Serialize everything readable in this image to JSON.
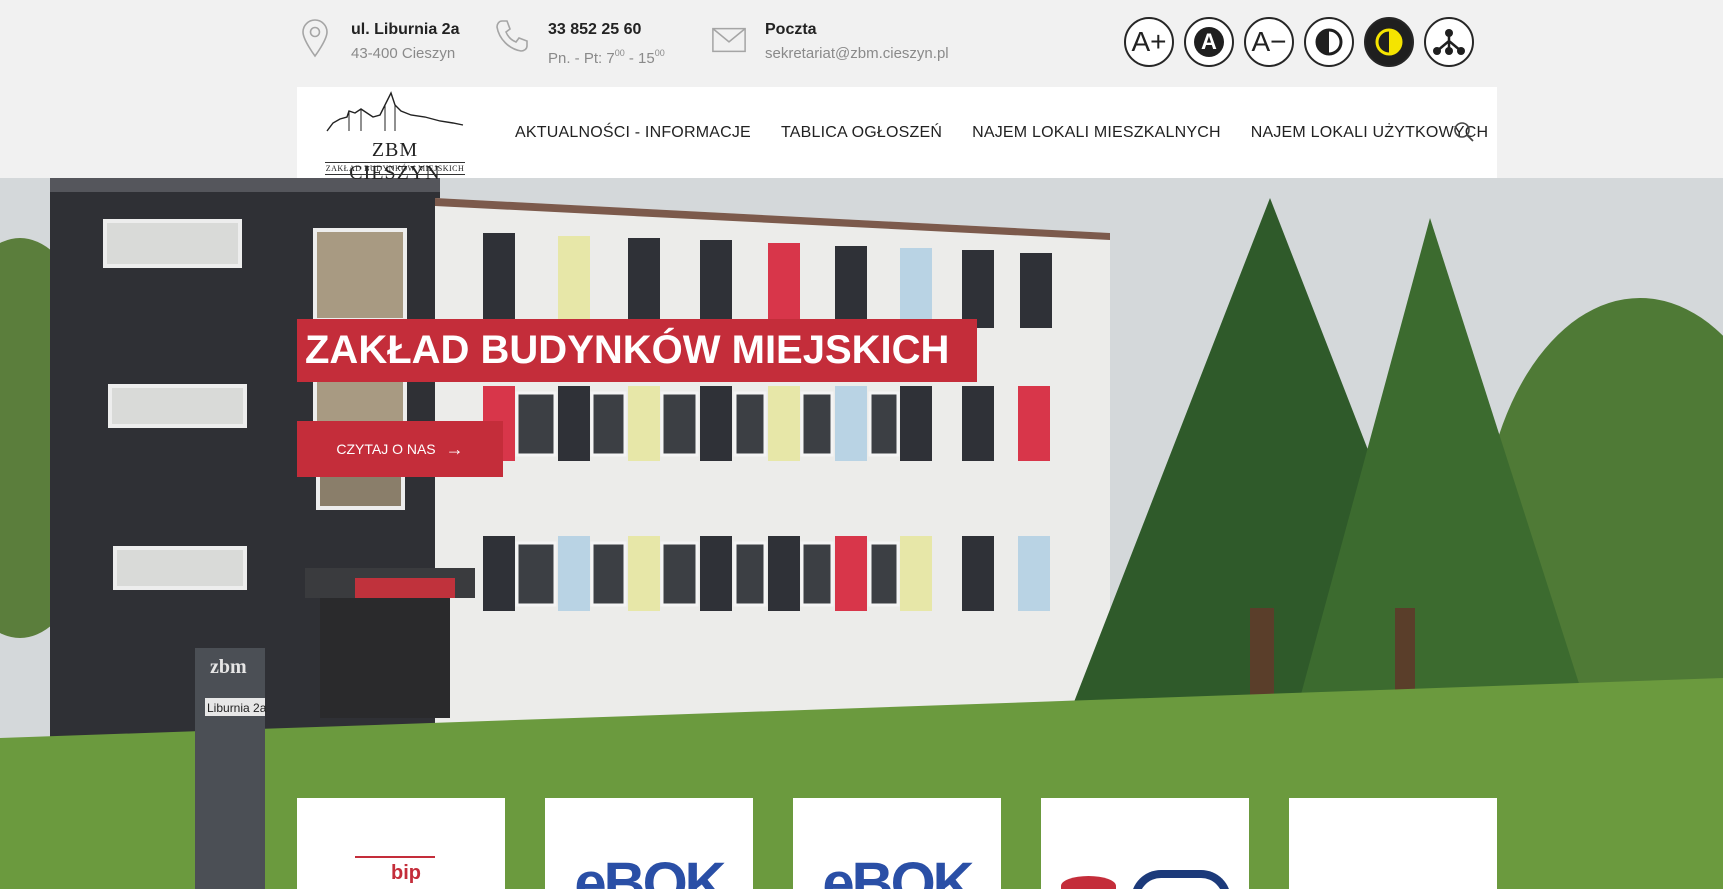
{
  "address": {
    "line1": "ul. Liburnia 2a",
    "line2": "43-400 Cieszyn"
  },
  "phone": {
    "line1": "33 852 25 60",
    "hours_prefix": "Pn. - Pt: 7",
    "hours_sup1": "00",
    "hours_mid": " - 15",
    "hours_sup2": "00"
  },
  "mail": {
    "line1": "Poczta",
    "line2": "sekretariat@zbm.cieszyn.pl"
  },
  "accessibility": {
    "font_increase": "A+",
    "font_default": "A",
    "font_decrease": "A−"
  },
  "logo": {
    "name": "ZBM CIESZYN",
    "subtitle": "ZAKŁAD BUDYNKÓW MIEJSKICH"
  },
  "nav": {
    "items": [
      {
        "label": "AKTUALNOŚCI - INFORMACJE"
      },
      {
        "label": "TABLICA OGŁOSZEŃ"
      },
      {
        "label": "NAJEM LOKALI MIESZKALNYCH"
      },
      {
        "label": "NAJEM LOKALI UŻYTKOWYCH"
      }
    ]
  },
  "hero": {
    "title": "ZAKŁAD BUDYNKÓW MIEJSKICH",
    "cta_label": "CZYTAJ O NAS",
    "sign_text": "Liburnia 2a",
    "sign_brand": "zbm"
  },
  "tiles": [
    {
      "label": "bip"
    },
    {
      "label": "eBOK"
    },
    {
      "label": "eBOK"
    },
    {
      "label": ""
    },
    {
      "label": ""
    }
  ],
  "colors": {
    "accent": "#c42d3a",
    "top_bg": "#f1f1f1",
    "contrast_yellow": "#f5e400"
  }
}
